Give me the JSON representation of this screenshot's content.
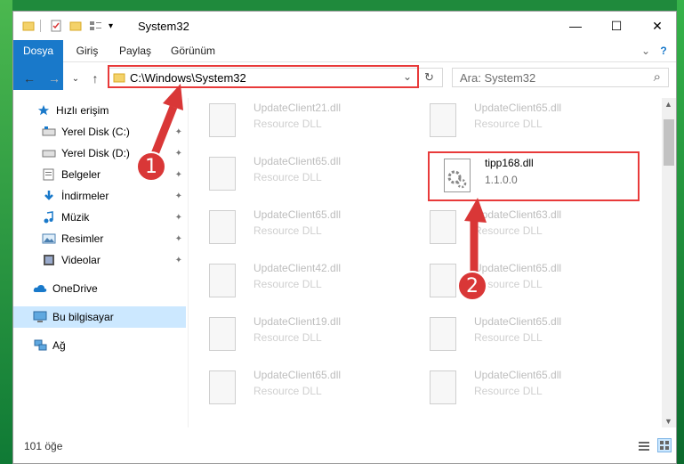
{
  "window": {
    "title": "System32",
    "minimize": "—",
    "maximize": "☐",
    "close": "✕"
  },
  "ribbon": {
    "tabs": [
      "Dosya",
      "Giriş",
      "Paylaş",
      "Görünüm"
    ],
    "help": "?",
    "expand": "⌄"
  },
  "nav": {
    "back": "←",
    "forward": "→",
    "recent": "⌄",
    "up": "↑",
    "address": "C:\\Windows\\System32",
    "dropdown": "⌄",
    "refresh": "↻",
    "search_placeholder": "Ara: System32",
    "search_icon": "⌕"
  },
  "sidebar": {
    "items": [
      {
        "label": "Hızlı erişim",
        "icon": "star-icon"
      },
      {
        "label": "Yerel Disk (C:)",
        "icon": "drive-icon"
      },
      {
        "label": "Yerel Disk (D:)",
        "icon": "drive-icon"
      },
      {
        "label": "Belgeler",
        "icon": "documents-icon"
      },
      {
        "label": "İndirmeler",
        "icon": "download-icon"
      },
      {
        "label": "Müzik",
        "icon": "music-icon"
      },
      {
        "label": "Resimler",
        "icon": "pictures-icon"
      },
      {
        "label": "Videolar",
        "icon": "video-icon"
      },
      {
        "label": "OneDrive",
        "icon": "cloud-icon"
      },
      {
        "label": "Bu bilgisayar",
        "icon": "computer-icon"
      },
      {
        "label": "Ağ",
        "icon": "network-icon"
      }
    ],
    "pin": "📌"
  },
  "files": [
    {
      "name": "UpdateClient21.dll",
      "type": "Resource DLL"
    },
    {
      "name": "UpdateClient65.dll",
      "type": "Resource DLL"
    },
    {
      "name": "UpdateClient65.dll",
      "type": "Resource DLL"
    },
    {
      "name": "tipp168.dll",
      "type": "1.1.0.0"
    },
    {
      "name": "UpdateClient65.dll",
      "type": "Resource DLL"
    },
    {
      "name": "UpdateClient63.dll",
      "type": "Resource DLL"
    },
    {
      "name": "UpdateClient42.dll",
      "type": "Resource DLL"
    },
    {
      "name": "UpdateClient65.dll",
      "type": "Resource DLL"
    },
    {
      "name": "UpdateClient19.dll",
      "type": "Resource DLL"
    },
    {
      "name": "UpdateClient65.dll",
      "type": "Resource DLL"
    },
    {
      "name": "UpdateClient65.dll",
      "type": "Resource DLL"
    },
    {
      "name": "UpdateClient65.dll",
      "type": "Resource DLL"
    }
  ],
  "status": {
    "count": "101 öğe"
  },
  "annotations": {
    "step1": "1",
    "step2": "2",
    "color": "#d93737"
  }
}
